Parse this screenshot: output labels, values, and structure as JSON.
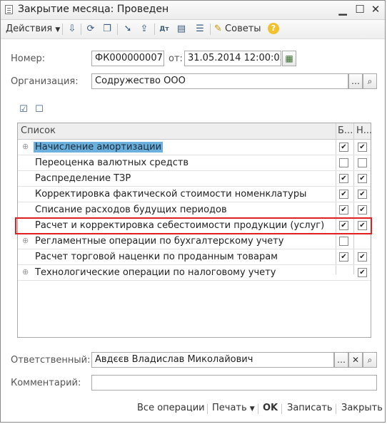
{
  "window": {
    "title": "Закрытие месяца: Проведен"
  },
  "toolbar": {
    "actions_label": "Действия",
    "advice_label": "Советы"
  },
  "form": {
    "number_label": "Номер:",
    "number_value": "ФК000000007",
    "date_label": "от:",
    "date_value": "31.05.2014 12:00:03",
    "org_label": "Организация:",
    "org_value": "Содружество ООО",
    "responsible_label": "Ответственный:",
    "responsible_value": "Авдєєв Владислав Миколайович",
    "comment_label": "Комментарий:",
    "comment_value": ""
  },
  "list": {
    "header": {
      "col_list": "Список",
      "col_b": "Б...",
      "col_n": "Н..."
    },
    "rows": [
      {
        "text": "Начисление амортизации",
        "expandable": true,
        "b": true,
        "n": true,
        "selected": true
      },
      {
        "text": "Переоценка валютных средств",
        "expandable": false,
        "b": false,
        "n": false
      },
      {
        "text": "Распределение ТЗР",
        "expandable": false,
        "b": true,
        "n": true
      },
      {
        "text": "Корректировка фактической стоимости номенклатуры",
        "expandable": false,
        "b": true,
        "n": true
      },
      {
        "text": "Списание расходов будущих периодов",
        "expandable": false,
        "b": true,
        "n": true
      },
      {
        "text": "Расчет и корректировка себестоимости продукции (услуг)",
        "expandable": false,
        "b": true,
        "n": true,
        "highlighted": true
      },
      {
        "text": "Регламентные операции по бухгалтерскому учету",
        "expandable": true,
        "b": false,
        "n": null
      },
      {
        "text": "Расчет торговой наценки по проданным товарам",
        "expandable": false,
        "b": true,
        "n": true
      },
      {
        "text": "Технологические операции по налоговому учету",
        "expandable": true,
        "b": null,
        "n": true
      }
    ]
  },
  "bottom": {
    "all_ops": "Все операции",
    "print": "Печать",
    "ok": "OK",
    "save": "Записать",
    "close": "Закрыть"
  },
  "colors": {
    "selection": "#6cb0de",
    "highlight_border": "#e02020"
  }
}
